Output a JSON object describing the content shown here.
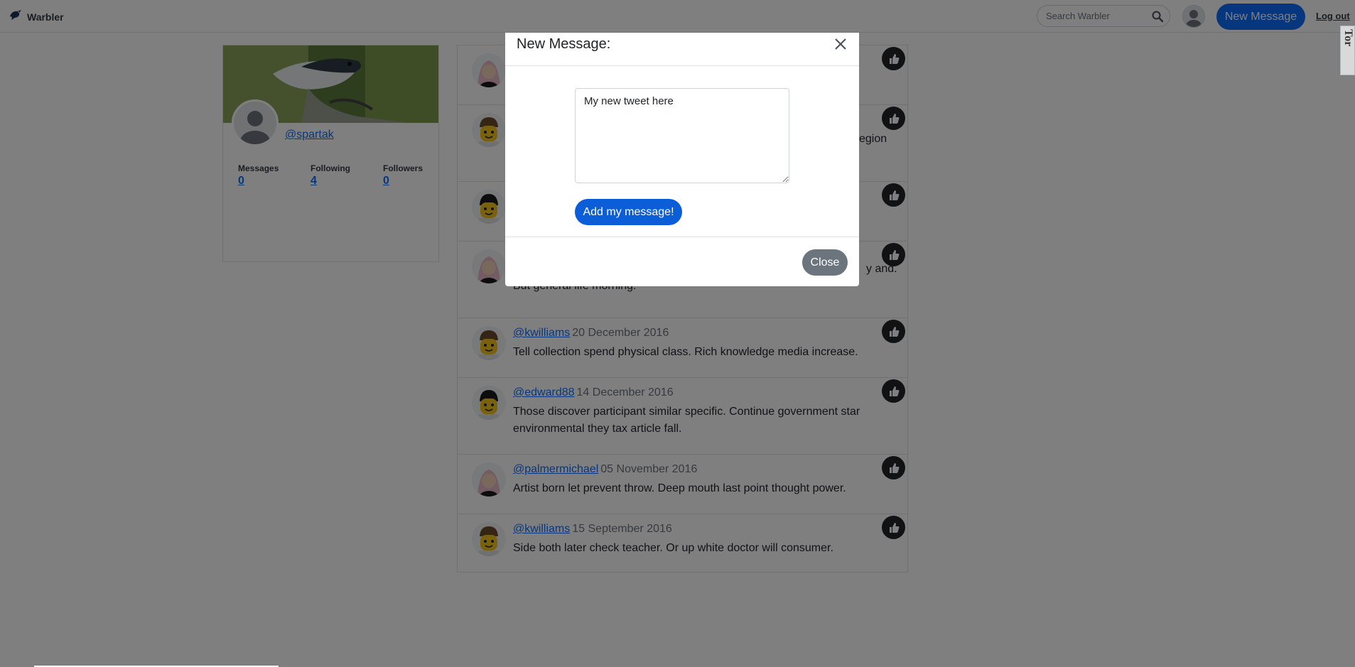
{
  "navbar": {
    "brand": "Warbler",
    "search_placeholder": "Search Warbler",
    "new_message_label": "New Message",
    "logout_label": "Log out"
  },
  "profile": {
    "username": "@spartak",
    "stats": [
      {
        "label": "Messages",
        "value": "0"
      },
      {
        "label": "Following",
        "value": "4"
      },
      {
        "label": "Followers",
        "value": "0"
      }
    ]
  },
  "messages": [
    {
      "user": "",
      "date": "",
      "text": "",
      "avatar": "woman"
    },
    {
      "user": "",
      "date": "",
      "text": "egion",
      "avatar": "brown-hair"
    },
    {
      "user": "",
      "date": "",
      "text": "",
      "avatar": "black-hair"
    },
    {
      "user": "",
      "date": "",
      "text_line1": "y and.",
      "text": "But general life morning.",
      "avatar": "woman"
    },
    {
      "user": "@kwilliams",
      "date": "20 December 2016",
      "text": "Tell collection spend physical class. Rich knowledge media increase.",
      "avatar": "brown-hair"
    },
    {
      "user": "@edward88",
      "date": "14 December 2016",
      "text": "Those discover participant similar specific. Continue government star environmental they tax article fall.",
      "avatar": "black-hair"
    },
    {
      "user": "@palmermichael",
      "date": "05 November 2016",
      "text": "Artist born let prevent throw. Deep mouth last point thought power.",
      "avatar": "woman"
    },
    {
      "user": "@kwilliams",
      "date": "15 September 2016",
      "text": "Side both later check teacher. Or up white doctor will consumer.",
      "avatar": "brown-hair"
    }
  ],
  "modal": {
    "title": "New Message:",
    "textarea_value": "My new tweet here",
    "submit_label": "Add my message!",
    "close_label": "Close"
  },
  "side_widget_text": "Tor"
}
